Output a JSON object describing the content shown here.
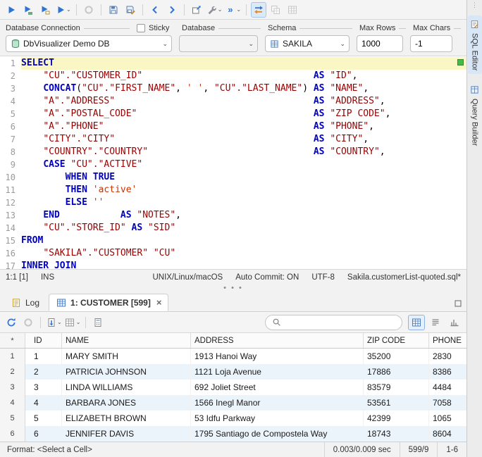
{
  "toolbar": {
    "buttons": [
      {
        "name": "execute-button",
        "icon": "play"
      },
      {
        "name": "execute-script-button",
        "icon": "play-script"
      },
      {
        "name": "execute-current-button",
        "icon": "play-current"
      },
      {
        "name": "execute-options-button",
        "icon": "play",
        "dropdown": true
      },
      {
        "sep": true
      },
      {
        "name": "stop-button",
        "icon": "record",
        "disabled": true
      },
      {
        "sep": true
      },
      {
        "name": "save-button",
        "icon": "save"
      },
      {
        "name": "save-as-button",
        "icon": "save-as"
      },
      {
        "sep": true
      },
      {
        "name": "history-back-button",
        "icon": "chev-left"
      },
      {
        "name": "history-forward-button",
        "icon": "chev-right"
      },
      {
        "sep": true
      },
      {
        "name": "open-in-new-tab-button",
        "icon": "window-arrow"
      },
      {
        "name": "editor-tools-button",
        "icon": "wrench",
        "dropdown": true
      },
      {
        "name": "more-commands-button",
        "icon": "double-arrow",
        "dropdown": true
      },
      {
        "sep": true
      },
      {
        "name": "pin-results-toggle",
        "icon": "swap-arrows",
        "active": true
      },
      {
        "name": "copy-selection-button",
        "icon": "grid-copy",
        "disabled": true
      },
      {
        "name": "grid-options-button",
        "icon": "grid",
        "disabled": true
      }
    ]
  },
  "connection_bar": {
    "connection_label": "Database Connection",
    "sticky_label": "Sticky",
    "database_label": "Database",
    "schema_label": "Schema",
    "max_rows_label": "Max Rows",
    "max_chars_label": "Max Chars",
    "connection_value": "DbVisualizer Demo DB",
    "database_value": "",
    "schema_value": "SAKILA",
    "max_rows_value": "1000",
    "max_chars_value": "-1",
    "sticky_checked": false
  },
  "editor": {
    "highlight_line": 1,
    "colors": {
      "keyword": "#0000C0",
      "identifier": "#990000",
      "string": "#CC3300",
      "current_line": "#FBF7C5"
    },
    "lines": [
      [
        [
          "k",
          "SELECT"
        ]
      ],
      [
        [
          "p",
          "    "
        ],
        [
          "i",
          "\"CU\".\"CUSTOMER_ID\""
        ],
        [
          "p",
          "                               "
        ],
        [
          "k",
          "AS"
        ],
        [
          "p",
          " "
        ],
        [
          "i",
          "\"ID\""
        ],
        [
          "p",
          ","
        ]
      ],
      [
        [
          "p",
          "    "
        ],
        [
          "k",
          "CONCAT"
        ],
        [
          "p",
          "("
        ],
        [
          "i",
          "\"CU\".\"FIRST_NAME\""
        ],
        [
          "p",
          ", "
        ],
        [
          "s",
          "' '"
        ],
        [
          "p",
          ", "
        ],
        [
          "i",
          "\"CU\".\"LAST_NAME\""
        ],
        [
          "p",
          ") "
        ],
        [
          "k",
          "AS"
        ],
        [
          "p",
          " "
        ],
        [
          "i",
          "\"NAME\""
        ],
        [
          "p",
          ","
        ]
      ],
      [
        [
          "p",
          "    "
        ],
        [
          "i",
          "\"A\".\"ADDRESS\""
        ],
        [
          "p",
          "                                    "
        ],
        [
          "k",
          "AS"
        ],
        [
          "p",
          " "
        ],
        [
          "i",
          "\"ADDRESS\""
        ],
        [
          "p",
          ","
        ]
      ],
      [
        [
          "p",
          "    "
        ],
        [
          "i",
          "\"A\".\"POSTAL_CODE\""
        ],
        [
          "p",
          "                                "
        ],
        [
          "k",
          "AS"
        ],
        [
          "p",
          " "
        ],
        [
          "i",
          "\"ZIP CODE\""
        ],
        [
          "p",
          ","
        ]
      ],
      [
        [
          "p",
          "    "
        ],
        [
          "i",
          "\"A\".\"PHONE\""
        ],
        [
          "p",
          "                                      "
        ],
        [
          "k",
          "AS"
        ],
        [
          "p",
          " "
        ],
        [
          "i",
          "\"PHONE\""
        ],
        [
          "p",
          ","
        ]
      ],
      [
        [
          "p",
          "    "
        ],
        [
          "i",
          "\"CITY\".\"CITY\""
        ],
        [
          "p",
          "                                    "
        ],
        [
          "k",
          "AS"
        ],
        [
          "p",
          " "
        ],
        [
          "i",
          "\"CITY\""
        ],
        [
          "p",
          ","
        ]
      ],
      [
        [
          "p",
          "    "
        ],
        [
          "i",
          "\"COUNTRY\".\"COUNTRY\""
        ],
        [
          "p",
          "                              "
        ],
        [
          "k",
          "AS"
        ],
        [
          "p",
          " "
        ],
        [
          "i",
          "\"COUNTRY\""
        ],
        [
          "p",
          ","
        ]
      ],
      [
        [
          "p",
          "    "
        ],
        [
          "k",
          "CASE"
        ],
        [
          "p",
          " "
        ],
        [
          "i",
          "\"CU\".\"ACTIVE\""
        ]
      ],
      [
        [
          "p",
          "        "
        ],
        [
          "k",
          "WHEN"
        ],
        [
          "p",
          " "
        ],
        [
          "k",
          "TRUE"
        ]
      ],
      [
        [
          "p",
          "        "
        ],
        [
          "k",
          "THEN"
        ],
        [
          "p",
          " "
        ],
        [
          "s",
          "'active'"
        ]
      ],
      [
        [
          "p",
          "        "
        ],
        [
          "k",
          "ELSE"
        ],
        [
          "p",
          " "
        ],
        [
          "s",
          "''"
        ]
      ],
      [
        [
          "p",
          "    "
        ],
        [
          "k",
          "END"
        ],
        [
          "p",
          "           "
        ],
        [
          "k",
          "AS"
        ],
        [
          "p",
          " "
        ],
        [
          "i",
          "\"NOTES\""
        ],
        [
          "p",
          ","
        ]
      ],
      [
        [
          "p",
          "    "
        ],
        [
          "i",
          "\"CU\".\"STORE_ID\""
        ],
        [
          "p",
          " "
        ],
        [
          "k",
          "AS"
        ],
        [
          "p",
          " "
        ],
        [
          "i",
          "\"SID\""
        ]
      ],
      [
        [
          "k",
          "FROM"
        ]
      ],
      [
        [
          "p",
          "    "
        ],
        [
          "i",
          "\"SAKILA\".\"CUSTOMER\""
        ],
        [
          "p",
          " "
        ],
        [
          "i",
          "\"CU\""
        ]
      ],
      [
        [
          "k",
          "INNER JOIN"
        ]
      ]
    ]
  },
  "editor_status": {
    "caret": "1:1 [1]",
    "mode": "INS",
    "line_ending": "UNIX/Linux/macOS",
    "auto_commit": "Auto Commit: ON",
    "encoding": "UTF-8",
    "file": "Sakila.customerList-quoted.sql*"
  },
  "results": {
    "tabs": [
      {
        "label": "Log",
        "selected": false
      },
      {
        "label": "1: CUSTOMER [599]",
        "selected": true,
        "closable": true
      }
    ],
    "toolbar": {
      "buttons": [
        {
          "name": "reload-button",
          "icon": "refresh"
        },
        {
          "name": "stop-load-button",
          "icon": "record",
          "disabled": true
        },
        {
          "sep": true
        },
        {
          "name": "export-grid-button",
          "icon": "export",
          "dropdown": true
        },
        {
          "name": "grid-mode-button",
          "icon": "grid",
          "dropdown": true
        },
        {
          "sep": true
        },
        {
          "name": "edit-options-button",
          "icon": "calc"
        }
      ],
      "search_placeholder": "",
      "search_value": "",
      "view_buttons": [
        {
          "name": "grid-view-button",
          "icon": "grid-view",
          "active": true
        },
        {
          "name": "text-view-button",
          "icon": "text-view",
          "active": false
        },
        {
          "name": "chart-view-button",
          "icon": "chart-view",
          "active": false
        }
      ]
    },
    "grid": {
      "columns": [
        "*",
        "ID",
        "NAME",
        "ADDRESS",
        "ZIP CODE",
        "PHONE"
      ],
      "rows": [
        {
          "num": "1",
          "id": "1",
          "name": "MARY SMITH",
          "address": "1913 Hanoi Way",
          "zip": "35200",
          "phone": "2830"
        },
        {
          "num": "2",
          "id": "2",
          "name": "PATRICIA JOHNSON",
          "address": "1121 Loja Avenue",
          "zip": "17886",
          "phone": "8386"
        },
        {
          "num": "3",
          "id": "3",
          "name": "LINDA WILLIAMS",
          "address": "692 Joliet Street",
          "zip": "83579",
          "phone": "4484"
        },
        {
          "num": "4",
          "id": "4",
          "name": "BARBARA JONES",
          "address": "1566 Inegl Manor",
          "zip": "53561",
          "phone": "7058"
        },
        {
          "num": "5",
          "id": "5",
          "name": "ELIZABETH BROWN",
          "address": "53 Idfu Parkway",
          "zip": "42399",
          "phone": "1065"
        },
        {
          "num": "6",
          "id": "6",
          "name": "JENNIFER DAVIS",
          "address": "1795 Santiago de Compostela Way",
          "zip": "18743",
          "phone": "8604"
        }
      ]
    },
    "status": {
      "format": "Format: <Select a Cell>",
      "time": "0.003/0.009 sec",
      "rows": "599/9",
      "range": "1-6"
    }
  },
  "side_tabs": [
    {
      "label": "SQL Editor",
      "selected": true
    },
    {
      "label": "Query Builder",
      "selected": false
    }
  ]
}
